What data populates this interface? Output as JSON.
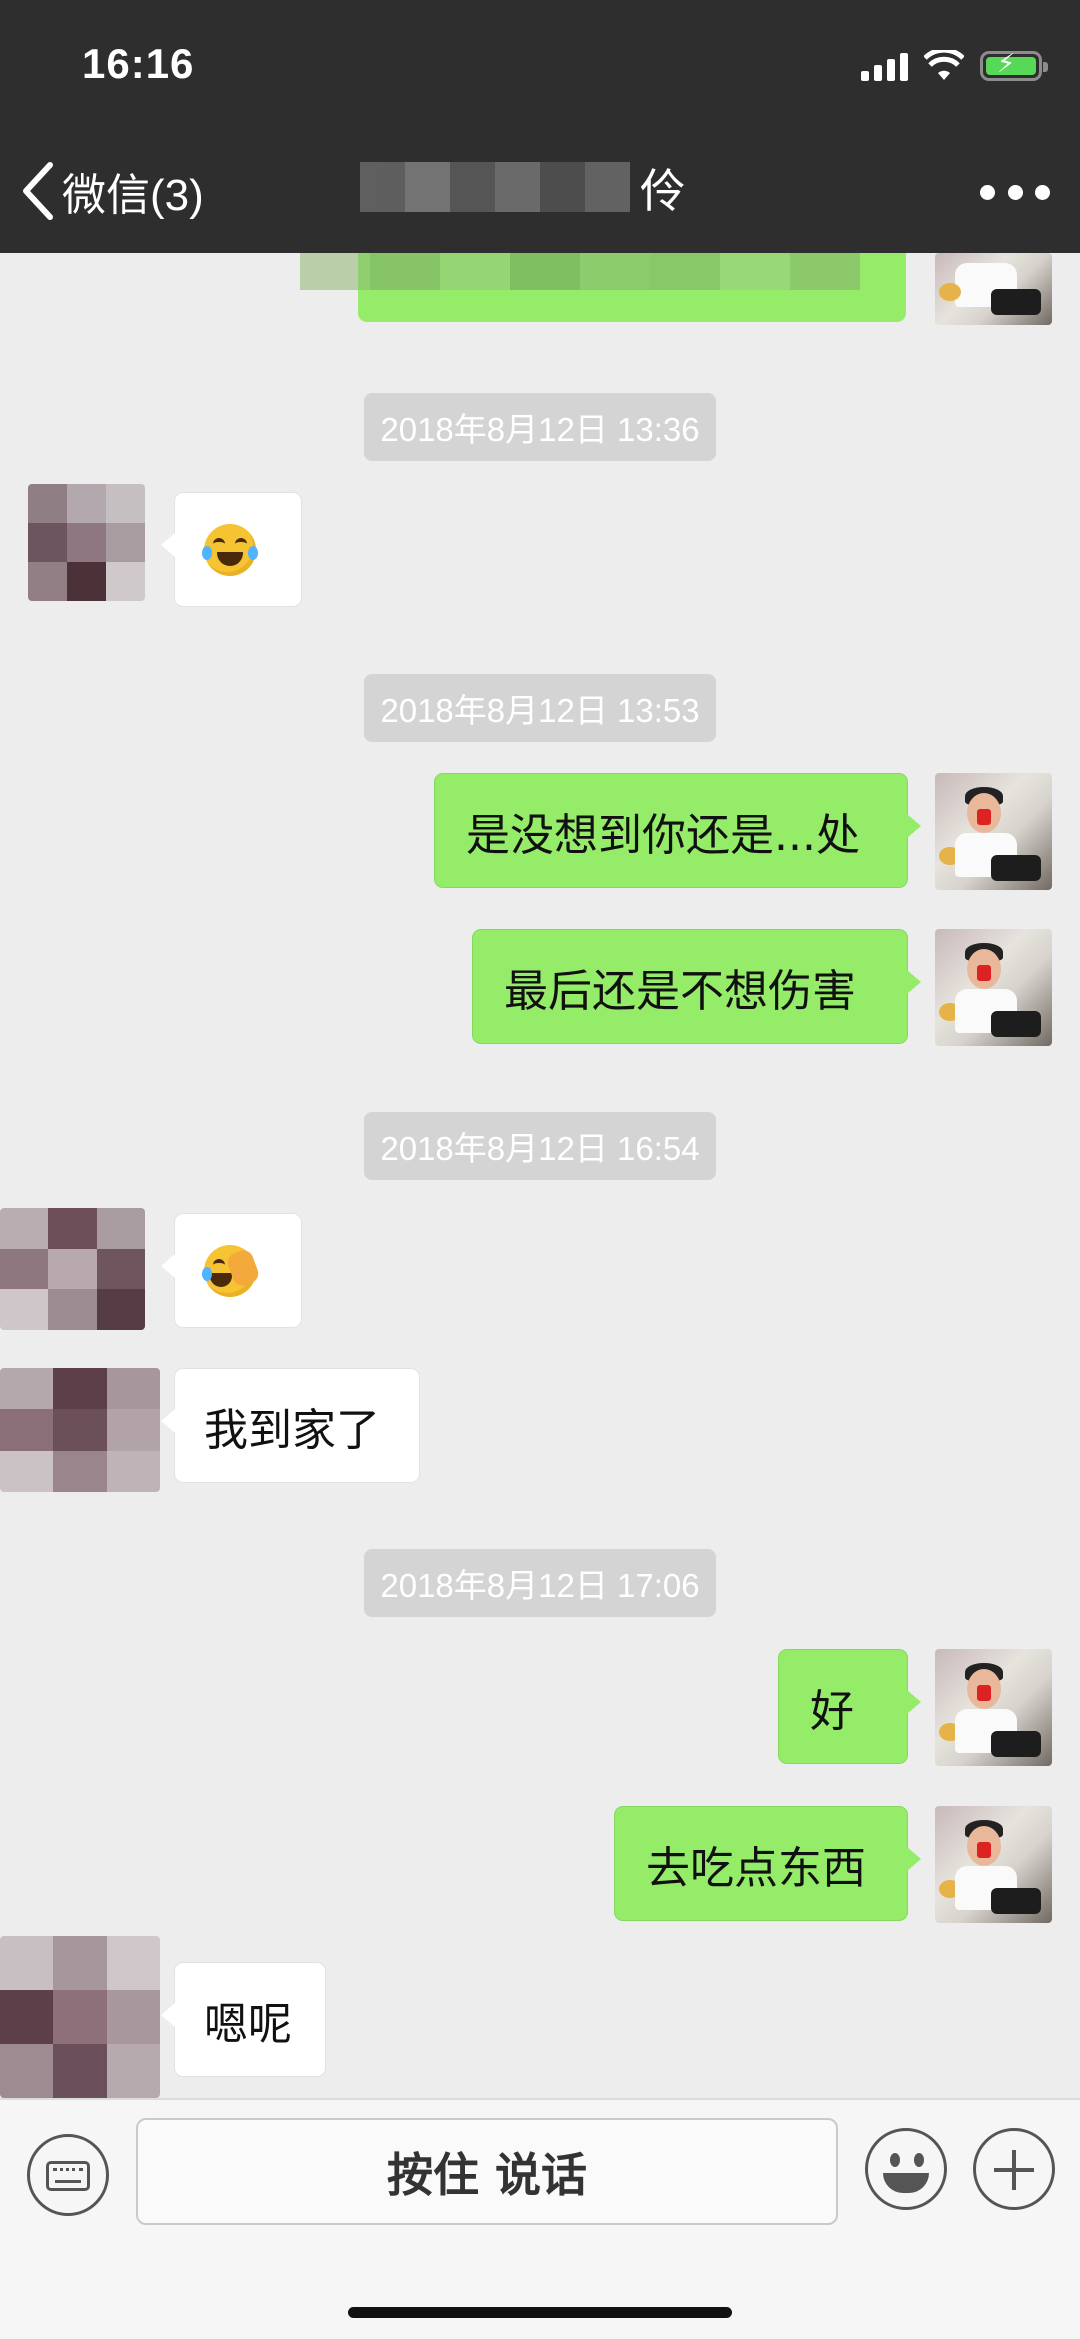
{
  "status_bar": {
    "time": "16:16"
  },
  "nav": {
    "back_label": "微信(3)",
    "title_visible_char": "伶"
  },
  "messages": [
    {
      "type": "timestamp",
      "text": "2018年8月12日 13:36"
    },
    {
      "type": "in",
      "emoji": "laughing-crying-emoji"
    },
    {
      "type": "timestamp",
      "text": "2018年8月12日 13:53"
    },
    {
      "type": "out",
      "text": "是没想到你还是...处"
    },
    {
      "type": "out",
      "text": "最后还是不想伤害"
    },
    {
      "type": "timestamp",
      "text": "2018年8月12日 16:54"
    },
    {
      "type": "in",
      "emoji": "facepalm-emoji"
    },
    {
      "type": "in",
      "text": "我到家了"
    },
    {
      "type": "timestamp",
      "text": "2018年8月12日 17:06"
    },
    {
      "type": "out",
      "text": "好"
    },
    {
      "type": "out",
      "text": "去吃点东西"
    },
    {
      "type": "in",
      "text": "嗯呢"
    }
  ],
  "input_bar": {
    "voice_label": "按住 说话",
    "keyboard_icon": "keyboard-icon",
    "emoji_icon": "emoji-icon",
    "plus_icon": "plus-icon"
  },
  "colors": {
    "header_bg": "#2e2e2e",
    "chat_bg": "#ededed",
    "out_bubble": "#95ec69",
    "in_bubble": "#ffffff",
    "timestamp_bg": "#d4d4d4"
  }
}
